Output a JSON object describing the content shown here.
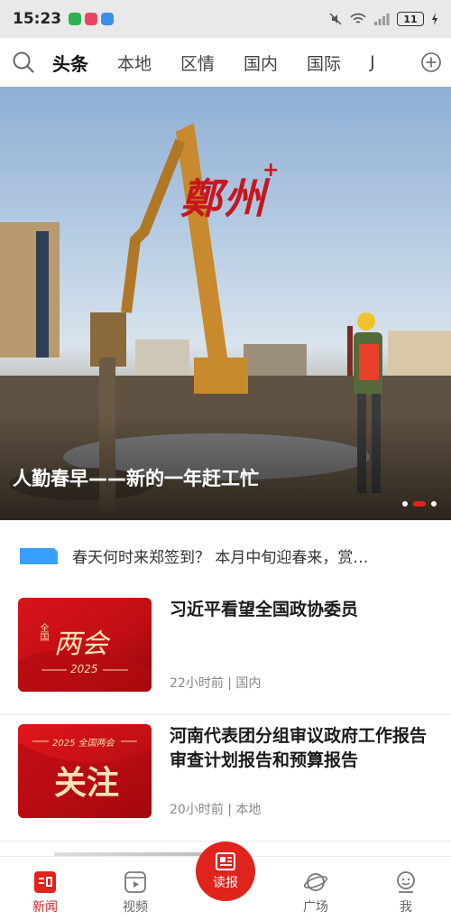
{
  "status_bar": {
    "time": "15:23",
    "battery": "11"
  },
  "top_nav": {
    "tabs": [
      "头条",
      "本地",
      "区情",
      "国内",
      "国际",
      "J"
    ]
  },
  "banner": {
    "logo": "鄭州",
    "caption": "人勤春早——新的一年赶工忙",
    "active_dot": 1
  },
  "ticker": {
    "text": "春天何时来郑签到？ 本月中旬迎春来，赏…"
  },
  "news": [
    {
      "title": "习近平看望全国政协委员",
      "meta": "22小时前 | 国内",
      "thumb": {
        "line1": "全国",
        "main": "两会",
        "year": "2025"
      }
    },
    {
      "title": "河南代表团分组审议政府工作报告 审查计划报告和预算报告",
      "meta": "20小时前 | 本地",
      "thumb": {
        "line1": "2025 全国两会",
        "main": "关注"
      }
    }
  ],
  "bottom_nav": {
    "items": [
      "新闻",
      "视频",
      "读报",
      "广场",
      "我"
    ],
    "active": 0
  },
  "colors": {
    "accent": "#e0231c",
    "status_bar_bg": "#e9e9e9",
    "ticker_tag": "#3aa0ff"
  }
}
